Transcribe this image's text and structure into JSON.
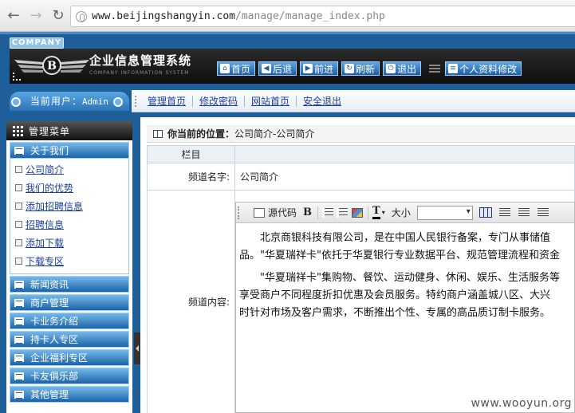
{
  "browser": {
    "url_host": "www.beijingshangyin.com",
    "url_path": "/manage/manage_index.php",
    "back_icon": "back-arrow-icon",
    "forward_icon": "forward-arrow-icon",
    "reload_icon": "reload-icon"
  },
  "header": {
    "company_tag": "COMPANY",
    "title": "企业信息管理系统",
    "subtitle": "COMPANY INFORMATION SYSTEM",
    "toolbar": {
      "home": "首页",
      "back": "后退",
      "forward": "前进",
      "refresh": "刷新",
      "logout": "退出",
      "profile": "个人资料修改"
    }
  },
  "user": {
    "label": "当前用户：",
    "name": "Admin"
  },
  "quick_links": [
    "管理首页",
    "修改密码",
    "网站首页",
    "安全退出"
  ],
  "sidebar": {
    "heading": "管理菜单",
    "groups": [
      {
        "label": "关于我们",
        "expanded": true,
        "items": [
          "公司简介",
          "我们的优势",
          "添加招聘信息",
          "招聘信息",
          "添加下载",
          "下载专区"
        ]
      },
      {
        "label": "新闻资讯"
      },
      {
        "label": "商户管理"
      },
      {
        "label": "卡业务介绍"
      },
      {
        "label": "持卡人专区"
      },
      {
        "label": "企业福利专区"
      },
      {
        "label": "卡友俱乐部"
      },
      {
        "label": "其他管理"
      }
    ]
  },
  "main": {
    "position_label": "你当前的位置：",
    "position_value": "公司简介-公司简介",
    "column_header": "栏目",
    "channel_name_label": "频道名字:",
    "channel_name_value": "公司简介",
    "channel_content_label": "频道内容:",
    "editor": {
      "source_code": "源代码",
      "bold": "B",
      "font_size": "大小",
      "text_color_glyph": "T",
      "paragraphs": [
        "北京商银科技有限公司，是在中国人民银行备案，专门从事储值",
        "品。\"华夏瑞祥卡\"依托于华夏银行专业数据平台、规范管理流程和资金",
        "\"华夏瑞祥卡\"集购物、餐饮、运动健身、休闲、娱乐、生活服务等",
        "享受商户不同程度折扣优惠及会员服务。特约商户涵盖城八区、大兴",
        "时针对市场及客户需求，不断推出个性、专属的高品质订制卡服务。"
      ]
    }
  },
  "watermark": "www.wooyun.org"
}
